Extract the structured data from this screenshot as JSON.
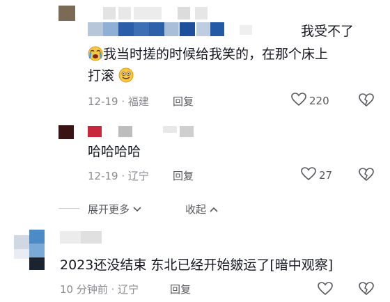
{
  "comment1": {
    "reply_prefix": "我受不了",
    "line1": "我当时搓的时候给我笑的，在那个床上",
    "line2": "打滚",
    "date_loc": "12-19 · 福建",
    "reply_label": "回复",
    "likes": "220"
  },
  "comment2": {
    "text": "哈哈哈哈",
    "date_loc": "12-19 · 辽宁",
    "reply_label": "回复",
    "likes": "27"
  },
  "thread_controls": {
    "expand": "展开更多",
    "collapse": "收起"
  },
  "comment3": {
    "text": "2023还没结束 东北已经开始皴运了[暗中观察]",
    "date_loc": "10 分钟前 · 辽宁",
    "reply_label": "回复"
  },
  "colors": {
    "text": "#161823",
    "meta": "#8a8b91",
    "accent_blue": "#1e4f9c"
  },
  "icons": [
    "heart-icon",
    "dislike-heart-icon",
    "crying-emoji-icon",
    "smile-emoji-icon",
    "chevron-down-icon",
    "chevron-up-icon"
  ]
}
